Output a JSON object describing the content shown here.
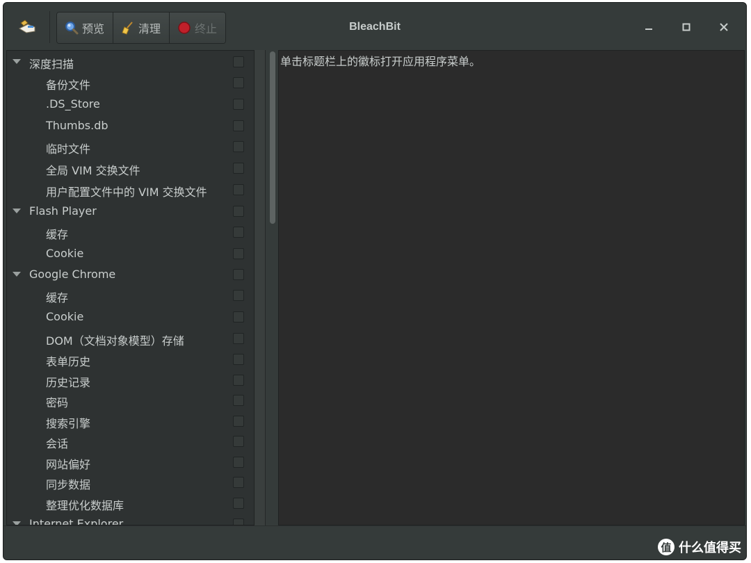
{
  "window": {
    "title": "BleachBit"
  },
  "toolbar": {
    "preview_label": "预览",
    "clean_label": "清理",
    "stop_label": "终止"
  },
  "icons": {
    "app_menu": "bleachbit-app-icon",
    "preview": "magnifier-icon",
    "clean": "broom-icon",
    "stop": "stop-icon",
    "minimize": "minimize-icon",
    "maximize": "maximize-icon",
    "close": "close-icon"
  },
  "tree": [
    {
      "label": "深度扫描",
      "level": "parent",
      "expanded": true,
      "checked": false
    },
    {
      "label": "备份文件",
      "level": "child",
      "checked": false
    },
    {
      "label": ".DS_Store",
      "level": "child",
      "checked": false
    },
    {
      "label": "Thumbs.db",
      "level": "child",
      "checked": false
    },
    {
      "label": "临时文件",
      "level": "child",
      "checked": false
    },
    {
      "label": "全局 VIM 交换文件",
      "level": "child",
      "checked": false
    },
    {
      "label": "用户配置文件中的 VIM 交换文件",
      "level": "child",
      "checked": false
    },
    {
      "label": "Flash Player",
      "level": "parent",
      "expanded": true,
      "checked": false
    },
    {
      "label": "缓存",
      "level": "child",
      "checked": false
    },
    {
      "label": "Cookie",
      "level": "child",
      "checked": false
    },
    {
      "label": "Google Chrome",
      "level": "parent",
      "expanded": true,
      "checked": false
    },
    {
      "label": "缓存",
      "level": "child",
      "checked": false
    },
    {
      "label": "Cookie",
      "level": "child",
      "checked": false
    },
    {
      "label": "DOM（文档对象模型）存储",
      "level": "child",
      "checked": false
    },
    {
      "label": "表单历史",
      "level": "child",
      "checked": false
    },
    {
      "label": "历史记录",
      "level": "child",
      "checked": false
    },
    {
      "label": "密码",
      "level": "child",
      "checked": false
    },
    {
      "label": "搜索引擎",
      "level": "child",
      "checked": false
    },
    {
      "label": "会话",
      "level": "child",
      "checked": false
    },
    {
      "label": "网站偏好",
      "level": "child",
      "checked": false
    },
    {
      "label": "同步数据",
      "level": "child",
      "checked": false
    },
    {
      "label": "整理优化数据库",
      "level": "child",
      "checked": false
    },
    {
      "label": "Internet Explorer",
      "level": "parent",
      "expanded": true,
      "checked": false
    }
  ],
  "main": {
    "message": "单击标题栏上的徽标打开应用程序菜单。"
  },
  "watermark": {
    "badge": "值",
    "text": "什么值得买"
  }
}
